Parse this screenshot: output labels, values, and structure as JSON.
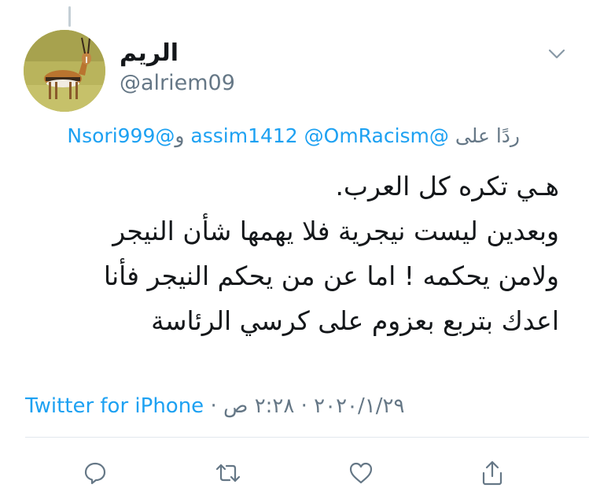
{
  "colors": {
    "text_primary": "#14171a",
    "text_secondary": "#657786",
    "link": "#1da1f2",
    "divider": "#e1e8ed"
  },
  "tweet": {
    "display_name": "الريم",
    "handle": "@alriem09",
    "reply_prefix": "ردًا على",
    "reply_mentions": [
      "@assim1412",
      "@OmRacism",
      "@Nsori999"
    ],
    "reply_conjunction": "و",
    "body_lines": [
      "هـي تكره كل العرب.",
      "وبعدين ليست نيجرية فلا يهمها شأن النيجر",
      "ولامن يحكمه ! اما عن من يحكم النيجر فأنا",
      "اعدك بتربع بعزوم على كرسي الرئاسة"
    ],
    "source": "Twitter for iPhone",
    "separator": " · ",
    "date": "٢٠٢٠/١/٢٩",
    "time": "٢:٢٨ ص"
  },
  "icons": {
    "caret": "chevron-down-icon",
    "reply": "reply-icon",
    "retweet": "retweet-icon",
    "like": "heart-icon",
    "share": "share-icon"
  }
}
